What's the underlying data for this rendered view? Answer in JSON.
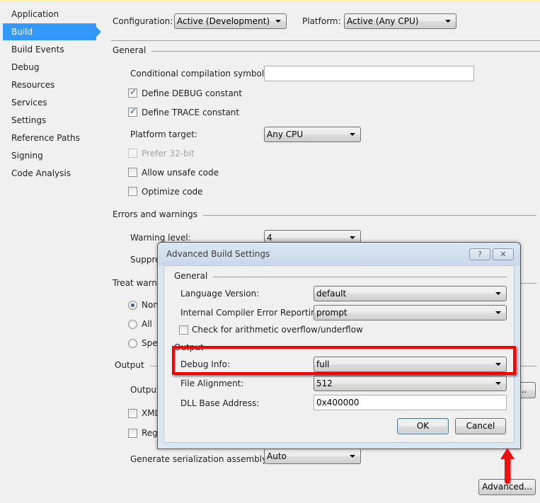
{
  "sidebar": {
    "items": [
      {
        "label": "Application"
      },
      {
        "label": "Build",
        "active": true
      },
      {
        "label": "Build Events"
      },
      {
        "label": "Debug"
      },
      {
        "label": "Resources"
      },
      {
        "label": "Services"
      },
      {
        "label": "Settings"
      },
      {
        "label": "Reference Paths"
      },
      {
        "label": "Signing"
      },
      {
        "label": "Code Analysis"
      }
    ]
  },
  "header": {
    "configuration_label": "Configuration:",
    "configuration_value": "Active (Development)",
    "platform_label": "Platform:",
    "platform_value": "Active (Any CPU)"
  },
  "general": {
    "title": "General",
    "symbols_label": "Conditional compilation symbols:",
    "symbols_value": "",
    "define_debug": {
      "label": "Define DEBUG constant",
      "checked": true
    },
    "define_trace": {
      "label": "Define TRACE constant",
      "checked": true
    },
    "platform_target_label": "Platform target:",
    "platform_target_value": "Any CPU",
    "prefer32": {
      "label": "Prefer 32-bit",
      "checked": false,
      "disabled": true
    },
    "allow_unsafe": {
      "label": "Allow unsafe code",
      "checked": false
    },
    "optimize": {
      "label": "Optimize code",
      "checked": false
    }
  },
  "errors": {
    "title": "Errors and warnings",
    "warning_level_label": "Warning level:",
    "warning_level_value": "4",
    "suppress_label": "Suppres"
  },
  "treat_warnings": {
    "title": "Treat warnin",
    "options": [
      {
        "label": "Non",
        "selected": true
      },
      {
        "label": "All",
        "selected": false
      },
      {
        "label": "Spec",
        "selected": false
      }
    ]
  },
  "output": {
    "title": "Output",
    "output_path_label": "Output",
    "xml_label": "XML",
    "register_label": "Regi",
    "serialization_label": "Generate serialization assembly:",
    "serialization_value": "Auto",
    "advanced_button": "Advanced...",
    "browse_button": "..."
  },
  "dialog": {
    "title": "Advanced Build Settings",
    "help_icon": "?",
    "close_icon": "✕",
    "general_title": "General",
    "language_version_label": "Language Version:",
    "language_version_value": "default",
    "ice_label": "Internal Compiler Error Reporting:",
    "ice_value": "prompt",
    "overflow": {
      "label": "Check for arithmetic overflow/underflow",
      "checked": false
    },
    "output_title": "Output",
    "debug_info_label": "Debug Info:",
    "debug_info_value": "full",
    "file_alignment_label": "File Alignment:",
    "file_alignment_value": "512",
    "dll_base_label": "DLL Base Address:",
    "dll_base_value": "0x400000",
    "ok_button": "OK",
    "cancel_button": "Cancel"
  },
  "annotation": {
    "highlight_color": "#ff0000",
    "arrow_color": "#ee1111"
  }
}
